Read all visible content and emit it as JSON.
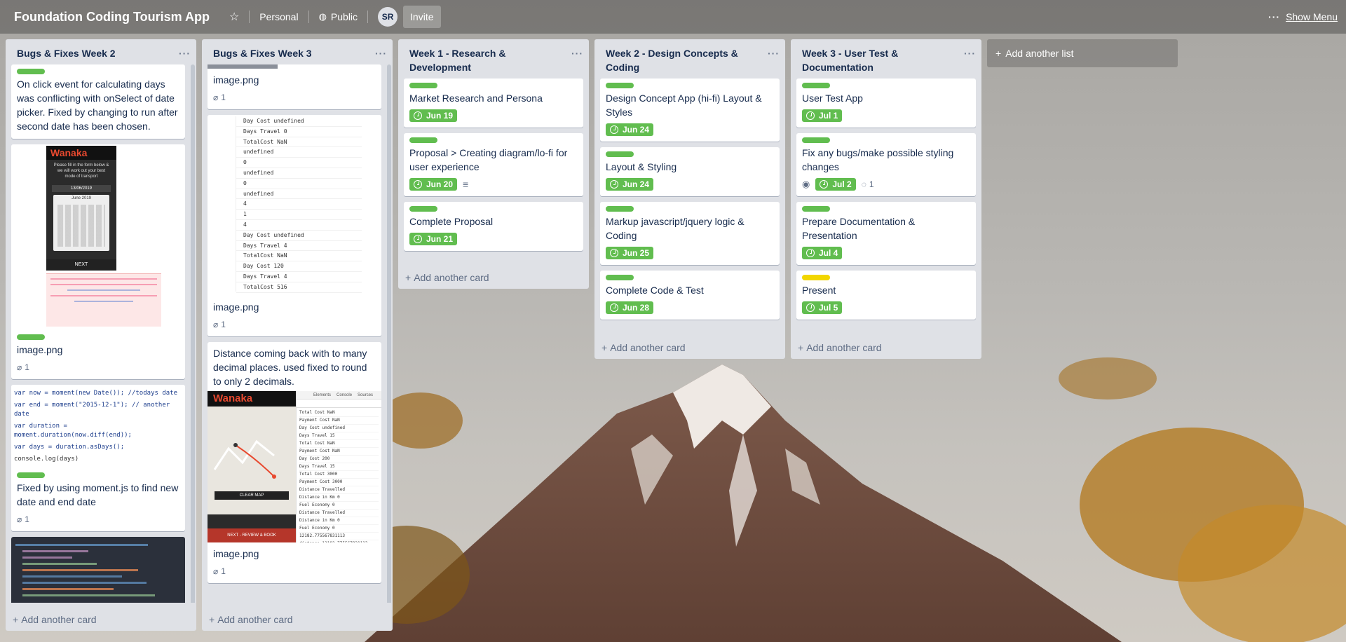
{
  "header": {
    "title": "Foundation Coding Tourism App",
    "team": "Personal",
    "visibility": "Public",
    "avatar_initials": "SR",
    "invite": "Invite",
    "show_menu": "Show Menu"
  },
  "colors": {
    "green_label": "#61bd4f",
    "yellow_label": "#f2d600",
    "list_bg": "#dfe1e6"
  },
  "lists": [
    {
      "title": "Bugs & Fixes Week 2",
      "cards": [
        {
          "label": "green",
          "title": "On click event for calculating days was conflicting with onSelect of date picker. Fixed by changing to run after second date has been chosen."
        },
        {
          "label": "green",
          "title": "image.png",
          "attachments": "1",
          "cover": {
            "brand": "Wanaka",
            "prompt": "Please fill in the form below & we will work out your best mode of transport",
            "date": "13/06/2019",
            "month": "June 2019",
            "next": "NEXT"
          }
        },
        {
          "label": "green",
          "title": "Fixed by using moment.js to find new date and end date",
          "attachments": "1",
          "code": [
            "var now = moment(new Date()); //todays date",
            "var end = moment(\"2015-12-1\"); // another date",
            "var duration = moment.duration(now.diff(end));",
            "var days = duration.asDays();",
            "console.log(days)"
          ]
        },
        {
          "label": "",
          "title": ""
        }
      ],
      "add_card": "Add another card"
    },
    {
      "title": "Bugs & Fixes Week 3",
      "cards": [
        {
          "title": "image.png",
          "attachments": "1"
        },
        {
          "title": "image.png",
          "attachments": "1",
          "log": [
            "Day Cost undefined",
            "Days Travel 0",
            "TotalCost NaN",
            "undefined",
            "0",
            "undefined",
            "0",
            "undefined",
            "4",
            "1",
            "4",
            "Day Cost undefined",
            "Days Travel 4",
            "TotalCost NaN",
            "Day Cost 120",
            "Days Travel 4",
            "TotalCost 516"
          ]
        },
        {
          "title": "Distance coming back with to many decimal places. used fixed to round to only 2 decimals."
        },
        {
          "title": "image.png",
          "attachments": "1",
          "cover": {
            "brand": "Wanaka",
            "clear": "CLEAR MAP",
            "next": "NEXT - REVIEW & BOOK",
            "tabs": [
              "Elements",
              "Console",
              "Sources"
            ],
            "console": [
              "Total Cost NaN",
              "Payment Cost NaN",
              "Day Cost undefined",
              "Days Travel 15",
              "Total Cost NaN",
              "Payment Cost NaN",
              "Day Cost 200",
              "Days Travel 15",
              "Total Cost 3000",
              "Payment Cost 3000",
              "Distance Travelled",
              "Distance in Km 0",
              "Fuel Economy 0",
              "Distance Travelled",
              "Distance in Km 0",
              "Fuel Economy 0",
              "12182.775567831113",
              "distance 12182.775567831113"
            ]
          }
        }
      ],
      "add_card": "Add another card"
    },
    {
      "title": "Week 1 - Research & Development",
      "cards": [
        {
          "label": "green",
          "title": "Market Research and Persona",
          "due": "Jun 19"
        },
        {
          "label": "green",
          "title": "Proposal > Creating diagram/lo-fi for user experience",
          "due": "Jun 20",
          "description": true
        },
        {
          "label": "green",
          "title": "Complete Proposal",
          "due": "Jun 21"
        }
      ],
      "add_card": "Add another card"
    },
    {
      "title": "Week 2 - Design Concepts & Coding",
      "cards": [
        {
          "label": "green",
          "title": "Design Concept App (hi-fi) Layout & Styles",
          "due": "Jun 24"
        },
        {
          "label": "green",
          "title": "Layout & Styling",
          "due": "Jun 24"
        },
        {
          "label": "green",
          "title": "Markup javascript/jquery logic & Coding",
          "due": "Jun 25"
        },
        {
          "label": "green",
          "title": "Complete Code & Test",
          "due": "Jun 28"
        }
      ],
      "add_card": "Add another card"
    },
    {
      "title": "Week 3 - User Test & Documentation",
      "cards": [
        {
          "label": "green",
          "title": "User Test App",
          "due": "Jul 1"
        },
        {
          "label": "green",
          "title": "Fix any bugs/make possible styling changes",
          "due": "Jul 2",
          "comments": "1",
          "watching": true
        },
        {
          "label": "green",
          "title": "Prepare Documentation & Presentation",
          "due": "Jul 4"
        },
        {
          "label": "yellow",
          "title": "Present",
          "due": "Jul 5"
        }
      ],
      "add_card": "Add another card"
    }
  ],
  "add_list": "Add another list"
}
